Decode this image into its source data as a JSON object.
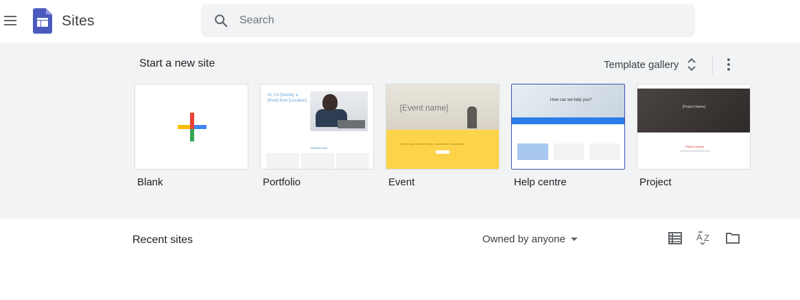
{
  "header": {
    "menu_icon": "hamburger-menu-icon",
    "logo_icon": "google-sites-logo",
    "app_title": "Sites",
    "search_placeholder": "Search",
    "search_icon": "search-icon"
  },
  "templates": {
    "section_title": "Start a new site",
    "gallery_label": "Template gallery",
    "gallery_icon": "unfold-more-icon",
    "more_icon": "more-vert-icon",
    "items": [
      {
        "name": "Blank",
        "thumb": {
          "plus_colors": [
            "#ea4335",
            "#4285f4",
            "#34a853",
            "#fbbc04"
          ]
        }
      },
      {
        "name": "Portfolio",
        "thumb": {
          "headline": "Hi, I'm [Name], a [Role] from [Location].",
          "label": "Selected work"
        }
      },
      {
        "name": "Event",
        "thumb": {
          "headline": "[Event name]",
          "tagline": "A three-day summit of talks, activities and workshops"
        }
      },
      {
        "name": "Help centre",
        "thumb": {
          "headline": "How can we help you?"
        }
      },
      {
        "name": "Project",
        "thumb": {
          "headline": "[Project Name]",
          "section": "Project mission"
        }
      }
    ]
  },
  "recent": {
    "title": "Recent sites",
    "owner_filter": "Owned by anyone",
    "owner_caret_icon": "arrow-drop-down-icon",
    "list_view_icon": "list-view-icon",
    "sort_icon": "sort-az-icon",
    "folder_icon": "folder-icon"
  },
  "colors": {
    "band_bg": "#f1f3f4",
    "search_bg": "#f1f3f4",
    "logo_blue": "#4b5bbd",
    "selected_border": "#3c4fb0"
  }
}
